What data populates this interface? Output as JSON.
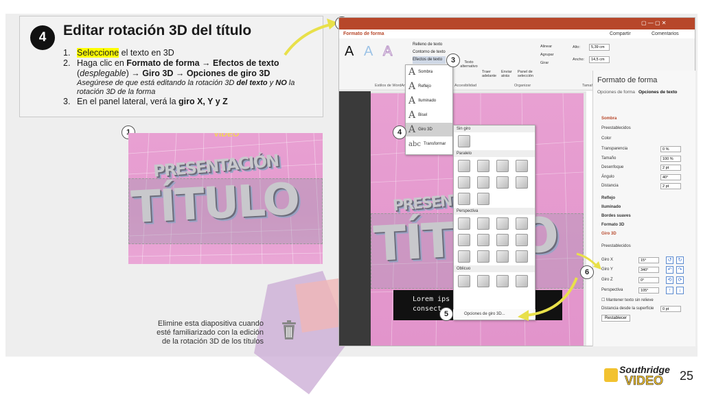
{
  "instructions": {
    "step": "4",
    "title": "Editar rotación 3D del título",
    "item1_num": "1.",
    "item1_hl": "Seleccione",
    "item1_rest": " el texto en 3D",
    "item2_num": "2.",
    "item2_a": "Haga clic en ",
    "item2_b": "Formato de forma",
    "item2_c": " → ",
    "item2_d": "Efectos de texto",
    "item2_e": "(",
    "item2_f": "desplegable",
    "item2_g": ") → ",
    "item2_h": "Giro 3D",
    "item2_i": " → ",
    "item2_j": "Opciones de giro 3D",
    "note_a": "Asegúrese de que está editando la rotación 3D ",
    "note_b": "del texto",
    "note_c": " y ",
    "note_d": "NO",
    "note_e": " la rotación 3D de la forma",
    "item3_num": "3.",
    "item3_a": "En el panel lateral, verá la ",
    "item3_b": "giro X, Y y Z"
  },
  "callouts": [
    "1",
    "2",
    "3",
    "4",
    "5",
    "6"
  ],
  "preview": {
    "top_text": "VIDEO",
    "subtitle": "PRESENTACIÓN",
    "title": "TÍTULO"
  },
  "delete_note": "Elimine esta diapositiva cuando esté familiarizado con la edición de la rotación 3D de los títulos",
  "ppt": {
    "tab": "Formato de forma",
    "share": "Compartir",
    "comments": "Comentarios",
    "wordart_label": "Estilos de WordArt",
    "fill": "Relleno de texto",
    "outline": "Contorno de texto",
    "effects": "Efectos de texto",
    "alt_text": "Texto alternativo",
    "accessibility": "Accesibilidad",
    "bring_forward": "Traer adelante",
    "send_back": "Enviar atrás",
    "selection_pane": "Panel de selección",
    "align": "Alinear",
    "group": "Agrupar",
    "rotate": "Girar",
    "organize": "Organizar",
    "height_label": "Alto:",
    "height_val": "5,39 cm",
    "width_label": "Ancho:",
    "width_val": "14,5 cm",
    "size_group": "Tamaño",
    "lorem_line1": "Lorem ips",
    "lorem_line2": "consect",
    "lorem_tail": "."
  },
  "fx_menu": [
    "Sombra",
    "Reflejo",
    "Iluminado",
    "Bisel",
    "Giro 3D",
    "Transformar"
  ],
  "gallery": {
    "no_rotation": "Sin giro",
    "parallel": "Paralelo",
    "perspective": "Perspectiva",
    "oblique": "Oblicuo",
    "options": "Opciones de giro 3D..."
  },
  "panel": {
    "title": "Formato de forma",
    "tab_shape": "Opciones de forma",
    "tab_text": "Opciones de texto",
    "shadow": "Sombra",
    "presets": "Preestablecidos",
    "color": "Color",
    "transparency": "Transparencia",
    "transparency_val": "0 %",
    "size": "Tamaño",
    "size_val": "100 %",
    "blur": "Desenfoque",
    "blur_val": "2 pt",
    "angle": "Ángulo",
    "angle_val": "40°",
    "distance": "Distancia",
    "distance_val": "2 pt",
    "reflection": "Reflejo",
    "glow": "Iluminado",
    "soft_edges": "Bordes suaves",
    "format3d": "Formato 3D",
    "rotation3d": "Giro 3D",
    "presets2": "Preestablecidos",
    "rot_x": "Giro X",
    "rot_x_val": "15°",
    "rot_y": "Giro Y",
    "rot_y_val": "340°",
    "rot_z": "Giro Z",
    "rot_z_val": "0°",
    "perspective": "Perspectiva",
    "perspective_val": "105°",
    "keep_flat": "Mantener texto sin relieve",
    "dist_surface": "Distancia desde la superficie",
    "dist_surface_val": "0 pt",
    "reset": "Restablecer"
  },
  "logo": {
    "line1": "Southridge",
    "line2": "VIDEO"
  },
  "page_number": "25",
  "colors": {
    "accent": "#b7472a",
    "highlight": "#ffff00",
    "arrow": "#e8e04a",
    "preview_pink": "#e59bcf"
  }
}
